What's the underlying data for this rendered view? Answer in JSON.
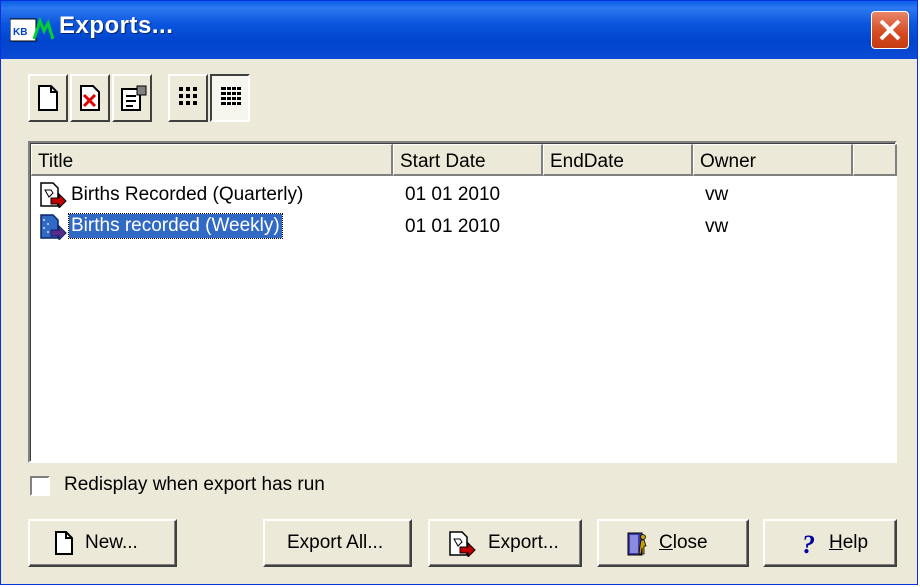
{
  "window": {
    "title": "Exports...",
    "app_icon": "kbf-app-icon"
  },
  "toolbar": {
    "buttons": [
      {
        "icon": "new-document-icon"
      },
      {
        "icon": "delete-document-icon"
      },
      {
        "icon": "properties-icon"
      },
      {
        "icon": "large-icons-view-icon"
      },
      {
        "icon": "details-view-icon",
        "pressed": true
      }
    ]
  },
  "list": {
    "columns": [
      "Title",
      "Start Date",
      "EndDate",
      "Owner"
    ],
    "rows": [
      {
        "title": "Births Recorded (Quarterly)",
        "start_date": "01 01 2010",
        "end_date": "",
        "owner": "vw",
        "icon": "export-document-icon"
      },
      {
        "title": "Births recorded (Weekly)",
        "start_date": "01 01 2010",
        "end_date": "",
        "owner": "vw",
        "icon": "export-document-selected-icon",
        "selected": true
      }
    ]
  },
  "options": {
    "redisplay_label": "Redisplay when export has run",
    "redisplay_checked": false
  },
  "buttons": {
    "new": "New...",
    "export_all": "Export All...",
    "export": "Export...",
    "close": "Close",
    "help": "Help"
  },
  "colors": {
    "titlebar": "#0a55dd",
    "selection": "#316ac5",
    "dialog_bg": "#ece9d8"
  }
}
